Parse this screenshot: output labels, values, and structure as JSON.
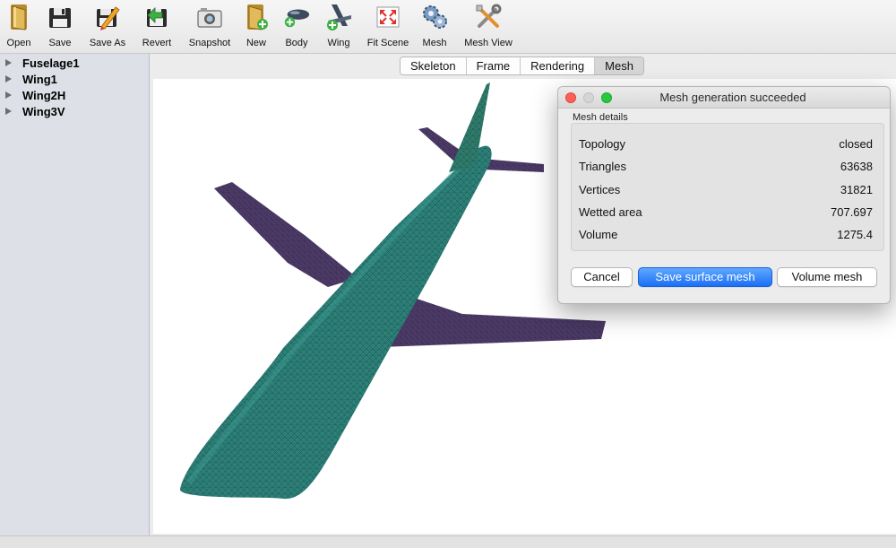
{
  "toolbar": {
    "buttons": [
      {
        "label": "Open",
        "icon": "folder-open-icon"
      },
      {
        "label": "Save",
        "icon": "floppy-disk-icon"
      },
      {
        "label": "Save As",
        "icon": "floppy-pencil-icon"
      },
      {
        "label": "Revert",
        "icon": "floppy-revert-icon"
      },
      {
        "label": "Snapshot",
        "icon": "camera-icon"
      },
      {
        "label": "New",
        "icon": "folder-new-icon"
      },
      {
        "label": "Body",
        "icon": "add-body-icon"
      },
      {
        "label": "Wing",
        "icon": "add-wing-icon"
      },
      {
        "label": "Fit Scene",
        "icon": "fit-scene-icon"
      },
      {
        "label": "Mesh",
        "icon": "mesh-gears-icon"
      },
      {
        "label": "Mesh View",
        "icon": "mesh-view-tools-icon"
      }
    ]
  },
  "tree": {
    "items": [
      {
        "label": "Fuselage1"
      },
      {
        "label": "Wing1"
      },
      {
        "label": "Wing2H"
      },
      {
        "label": "Wing3V"
      }
    ]
  },
  "tabs": [
    {
      "label": "Skeleton",
      "active": false
    },
    {
      "label": "Frame",
      "active": false
    },
    {
      "label": "Rendering",
      "active": false
    },
    {
      "label": "Mesh",
      "active": true
    }
  ],
  "viewport": {
    "colors": {
      "fuselage": "#2c8078",
      "wing": "#4b3a66",
      "mesh_line": "#1b3f3c"
    }
  },
  "dialog": {
    "title": "Mesh generation succeeded",
    "group_label": "Mesh details",
    "rows": [
      {
        "label": "Topology",
        "value": "closed"
      },
      {
        "label": "Triangles",
        "value": "63638"
      },
      {
        "label": "Vertices",
        "value": "31821"
      },
      {
        "label": "Wetted area",
        "value": "707.697"
      },
      {
        "label": "Volume",
        "value": "1275.4"
      }
    ],
    "buttons": {
      "cancel": "Cancel",
      "save": "Save surface mesh",
      "volume": "Volume mesh"
    }
  }
}
